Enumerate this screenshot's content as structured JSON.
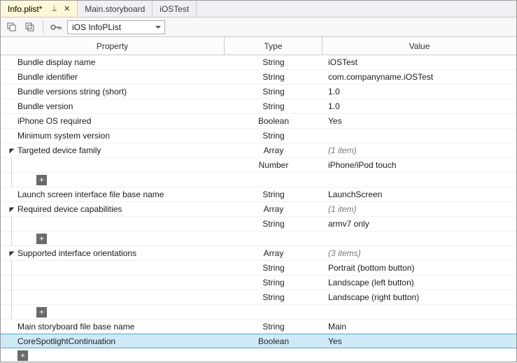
{
  "tabs": [
    {
      "label": "Info.plist*",
      "active": true,
      "pinned": true,
      "closable": true
    },
    {
      "label": "Main.storyboard",
      "active": false
    },
    {
      "label": "iOSTest",
      "active": false
    }
  ],
  "toolbar": {
    "expand_all": "expand-all",
    "collapse_all": "collapse-all",
    "key_icon": "key-icon",
    "selector_label": "iOS InfoPList"
  },
  "headers": {
    "property": "Property",
    "type": "Type",
    "value": "Value"
  },
  "rows": [
    {
      "prop": "Bundle display name",
      "type": "String",
      "value": "iOSTest"
    },
    {
      "prop": "Bundle identifier",
      "type": "String",
      "value": "com.companyname.iOSTest"
    },
    {
      "prop": "Bundle versions string (short)",
      "type": "String",
      "value": "1.0"
    },
    {
      "prop": "Bundle version",
      "type": "String",
      "value": "1.0"
    },
    {
      "prop": "iPhone OS required",
      "type": "Boolean",
      "value": "Yes"
    },
    {
      "prop": "Minimum system version",
      "type": "String",
      "value": ""
    },
    {
      "prop": "Targeted device family",
      "type": "Array",
      "value": "(1 item)",
      "expandable": true,
      "italic": true
    },
    {
      "prop": "",
      "type": "Number",
      "value": "iPhone/iPod touch",
      "child": true
    },
    {
      "add_child": true
    },
    {
      "prop": "Launch screen interface file base name",
      "type": "String",
      "value": "LaunchScreen"
    },
    {
      "prop": "Required device capabilities",
      "type": "Array",
      "value": "(1 item)",
      "expandable": true,
      "italic": true
    },
    {
      "prop": "",
      "type": "String",
      "value": "armv7 only",
      "child": true
    },
    {
      "add_child": true
    },
    {
      "prop": "Supported interface orientations",
      "type": "Array",
      "value": "(3 items)",
      "expandable": true,
      "italic": true
    },
    {
      "prop": "",
      "type": "String",
      "value": "Portrait (bottom button)",
      "child": true
    },
    {
      "prop": "",
      "type": "String",
      "value": "Landscape (left button)",
      "child": true
    },
    {
      "prop": "",
      "type": "String",
      "value": "Landscape (right button)",
      "child": true
    },
    {
      "add_child": true
    },
    {
      "prop": "Main storyboard file base name",
      "type": "String",
      "value": "Main"
    },
    {
      "prop": "CoreSpotlightContinuation",
      "type": "Boolean",
      "value": "Yes",
      "selected": true
    }
  ],
  "footer_add": "+"
}
